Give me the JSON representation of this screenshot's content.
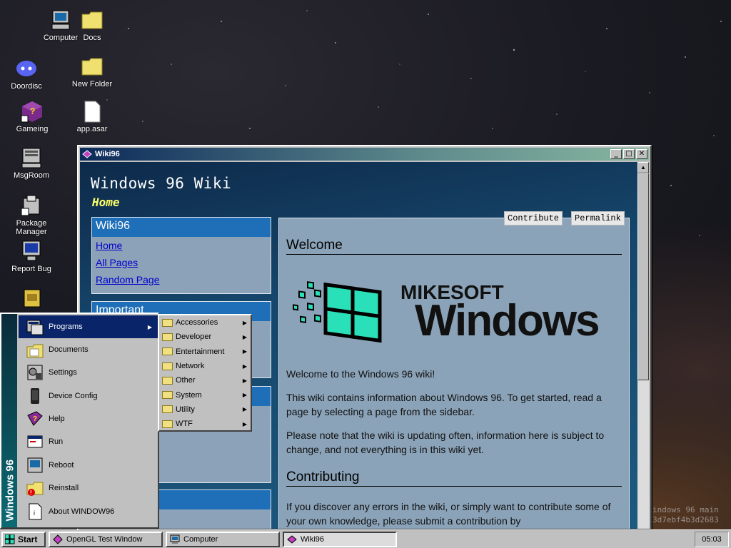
{
  "desktop": {
    "icons": [
      {
        "label": "Computer"
      },
      {
        "label": "Docs"
      },
      {
        "label": "Doordisc"
      },
      {
        "label": "New Folder"
      },
      {
        "label": "Gameing"
      },
      {
        "label": "app.asar"
      },
      {
        "label": "MsgRoom"
      },
      {
        "label": "Package Manager"
      },
      {
        "label": "Report Bug"
      }
    ],
    "watermark": [
      "indows 96 main",
      "3d7ebf4b3d2683"
    ]
  },
  "window": {
    "title": "Wiki96",
    "controls": {
      "minimize": "_",
      "maximize": "□",
      "close": "✕"
    },
    "heading": "Windows 96 Wiki",
    "subheading": "Home",
    "sidebar": {
      "box1": {
        "header": "Wiki96",
        "links": [
          "Home",
          "All Pages",
          "Random Page"
        ]
      },
      "box2": {
        "header": "Important"
      }
    },
    "page_buttons": {
      "contribute": "Contribute",
      "permalink": "Permalink"
    },
    "main": {
      "welcome_heading": "Welcome",
      "logo_top": "MIKESOFT",
      "logo_bottom": "Windows",
      "p1": "Welcome to the Windows 96 wiki!",
      "p2": "This wiki contains information about Windows 96. To get started, read a page by selecting a page from the sidebar.",
      "p3": "Please note that the wiki is updating often, information here is subject to change, and not everything is in this wiki yet.",
      "contributing_heading": "Contributing",
      "p4": "If you discover any errors in the wiki, or simply want to contribute some of your own knowledge, please submit a contribution by"
    }
  },
  "start_menu": {
    "sidebar_text": "Windows 96",
    "items": [
      {
        "label": "Programs",
        "has_submenu": true
      },
      {
        "label": "Documents"
      },
      {
        "label": "Settings"
      },
      {
        "label": "Device Config"
      },
      {
        "label": "Help"
      },
      {
        "label": "Run"
      },
      {
        "label": "Reboot"
      },
      {
        "label": "Reinstall"
      },
      {
        "label": "About WINDOW96"
      }
    ],
    "programs_submenu": [
      "Accessories",
      "Developer",
      "Entertainment",
      "Network",
      "Other",
      "System",
      "Utility",
      "WTF"
    ]
  },
  "taskbar": {
    "start_label": "Start",
    "items": [
      {
        "label": "OpenGL Test Window",
        "active": false
      },
      {
        "label": "Computer",
        "active": false
      },
      {
        "label": "Wiki96",
        "active": true
      }
    ],
    "clock": "05:03"
  },
  "colors": {
    "accent": "#0a246a",
    "wiki_link": "#0000cc",
    "wiki_header": "#1e6fb8",
    "subtitle": "#ffff66"
  }
}
